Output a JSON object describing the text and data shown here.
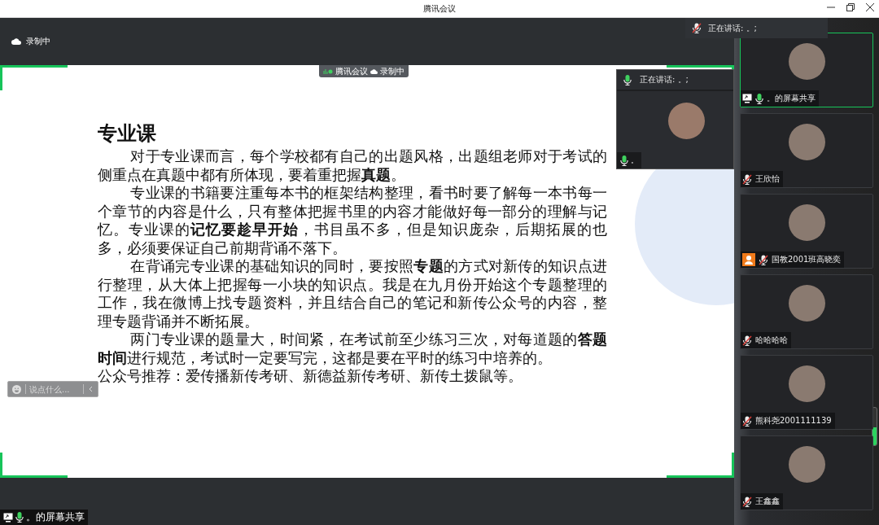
{
  "window": {
    "title": "腾讯会议"
  },
  "recording": {
    "label": "录制中"
  },
  "overlay_tag": {
    "app": "腾讯会议",
    "recording": "录制中"
  },
  "speaking_popup": {
    "text": "正在讲话: 。;"
  },
  "floating_video": {
    "header": "正在讲话: 。;",
    "name": "。",
    "muted": false
  },
  "slide": {
    "title": "专业课",
    "paragraphs": [
      {
        "text": "对于专业课而言，每个学校都有自己的出题风格，出题组老师对于考试的侧重点在真题中都有所体现，要着重把握**真题**。",
        "indent": true
      },
      {
        "text": "专业课的书籍要注重每本书的框架结构整理，看书时要了解每一本书每一个章节的内容是什么，只有整体把握书里的内容才能做好每一部分的理解与记忆。专业课的**记忆要趁早开始**，书目虽不多，但是知识庞杂，后期拓展的也多，必须要保证自己前期背诵不落下。",
        "indent": true
      },
      {
        "text": "在背诵完专业课的基础知识的同时，要按照**专题**的方式对新传的知识点进行整理，从大体上把握每一小块的知识点。我是在九月份开始这个专题整理的工作，我在微博上找专题资料，并且结合自己的笔记和新传公众号的内容，整理专题背诵并不断拓展。",
        "indent": true
      },
      {
        "text": "两门专业课的题量大，时间紧，在考试前至少练习三次，对每道题的**答题时间**进行规范，考试时一定要写完，这都是要在平时的练习中培养的。",
        "indent": true
      },
      {
        "text": "公众号推荐：爱传播新传考研、新德益新传考研、新传土拨鼠等。",
        "indent": false
      }
    ]
  },
  "chat_input": {
    "placeholder": "说点什么..."
  },
  "share_label": {
    "name": "。的屏幕共享",
    "muted": false
  },
  "participants": [
    {
      "name": "。的屏幕共享",
      "muted": false,
      "sharing": true,
      "host": false,
      "selected": true
    },
    {
      "name": "王欣怡",
      "muted": true,
      "sharing": false,
      "host": false,
      "selected": false
    },
    {
      "name": "国教2001班高晓奕",
      "muted": true,
      "sharing": false,
      "host": true,
      "selected": false
    },
    {
      "name": "哈哈哈哈",
      "muted": true,
      "sharing": false,
      "host": false,
      "selected": false
    },
    {
      "name": "熊科尧2001111139",
      "muted": true,
      "sharing": false,
      "host": false,
      "selected": false
    },
    {
      "name": "王鑫鑫",
      "muted": true,
      "sharing": false,
      "host": false,
      "selected": false
    }
  ]
}
